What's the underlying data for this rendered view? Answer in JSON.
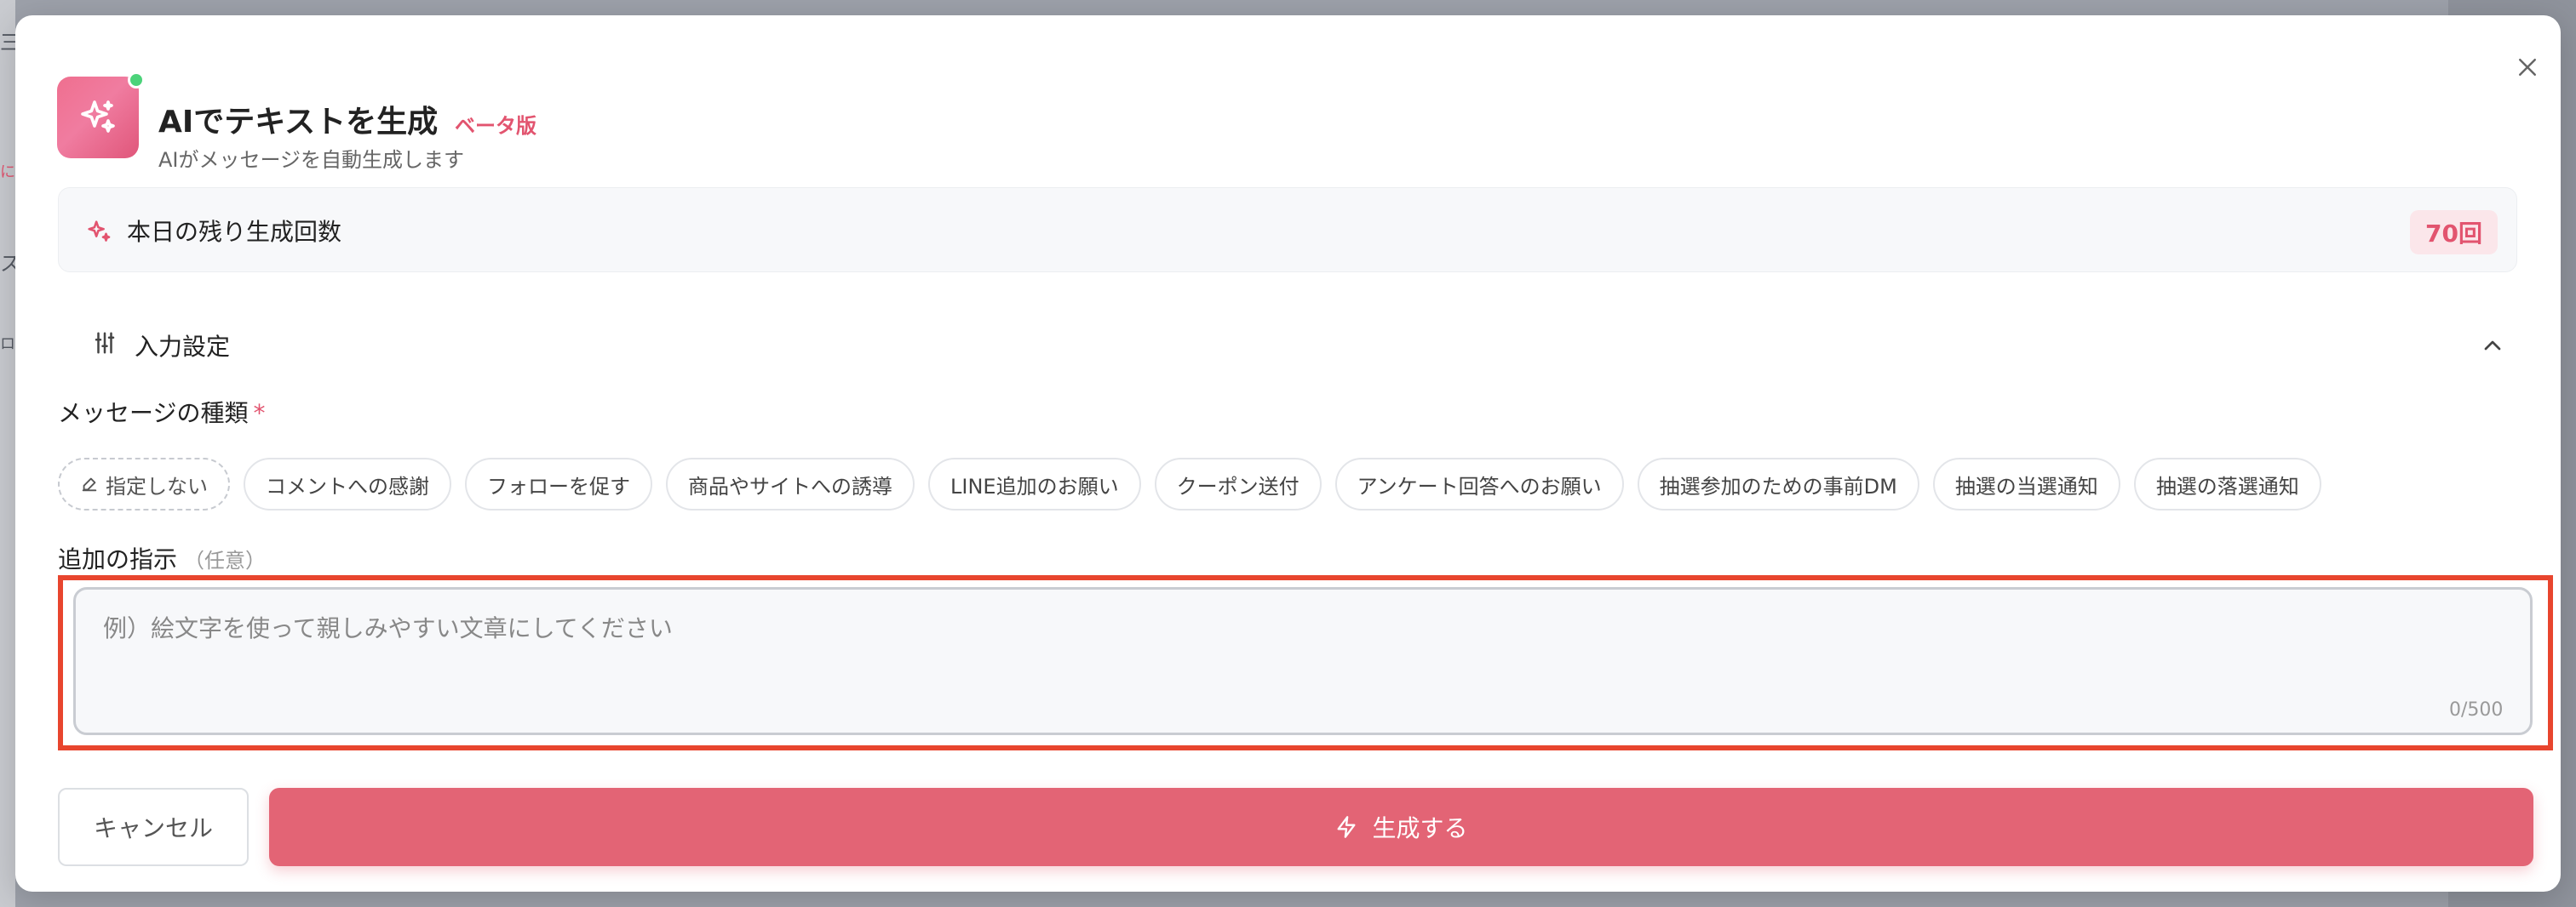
{
  "background": {
    "glyphs": [
      "三",
      "に",
      "ス",
      "ロ"
    ]
  },
  "dialog": {
    "title": "AIでテキストを生成",
    "badge": "ベータ版",
    "subtitle": "AIがメッセージを自動生成します",
    "close_icon": "close-icon"
  },
  "quota": {
    "label": "本日の残り生成回数",
    "value": "70回"
  },
  "settings": {
    "label": "入力設定"
  },
  "message_type": {
    "label": "メッセージの種類",
    "required_mark": "*",
    "options": [
      "指定しない",
      "コメントへの感謝",
      "フォローを促す",
      "商品やサイトへの誘導",
      "LINE追加のお願い",
      "クーポン送付",
      "アンケート回答へのお願い",
      "抽選参加のための事前DM",
      "抽選の当選通知",
      "抽選の落選通知"
    ]
  },
  "instructions": {
    "label": "追加の指示",
    "optional_text": "（任意）",
    "placeholder": "例）絵文字を使って親しみやすい文章にしてください",
    "counter": "0/500"
  },
  "actions": {
    "cancel_label": "キャンセル",
    "generate_label": "生成する"
  },
  "colors": {
    "accent": "#e36475",
    "brand_pink": "#e2546f",
    "highlight": "#e8452e"
  }
}
